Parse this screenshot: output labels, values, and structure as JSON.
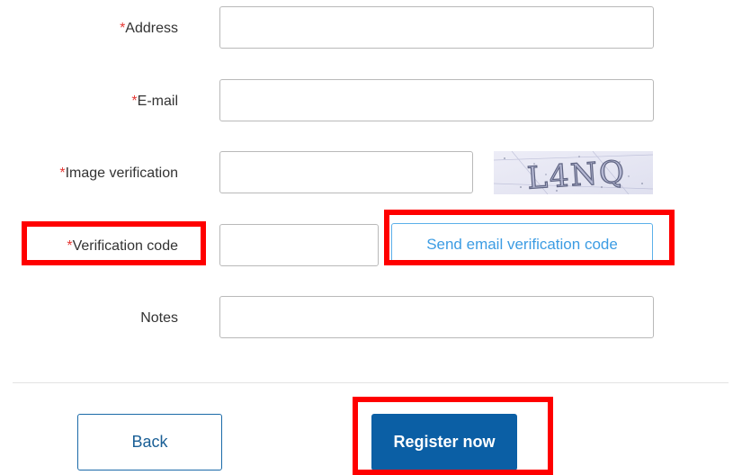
{
  "form": {
    "required_marker": "*",
    "address": {
      "label": "Address",
      "value": "",
      "required": true
    },
    "email": {
      "label": "E-mail",
      "value": "",
      "required": true
    },
    "image_verification": {
      "label": "Image verification",
      "value": "",
      "required": true,
      "captcha_text": "L4NQ"
    },
    "verification_code": {
      "label": "Verification code",
      "value": "",
      "required": true,
      "send_button_label": "Send email verification code"
    },
    "notes": {
      "label": "Notes",
      "value": "",
      "required": false
    }
  },
  "actions": {
    "back_label": "Back",
    "register_label": "Register now"
  },
  "colors": {
    "required_marker": "#e53935",
    "highlight": "#ff0000",
    "primary_button": "#0b5fa5",
    "link_blue": "#3c9ce3"
  }
}
